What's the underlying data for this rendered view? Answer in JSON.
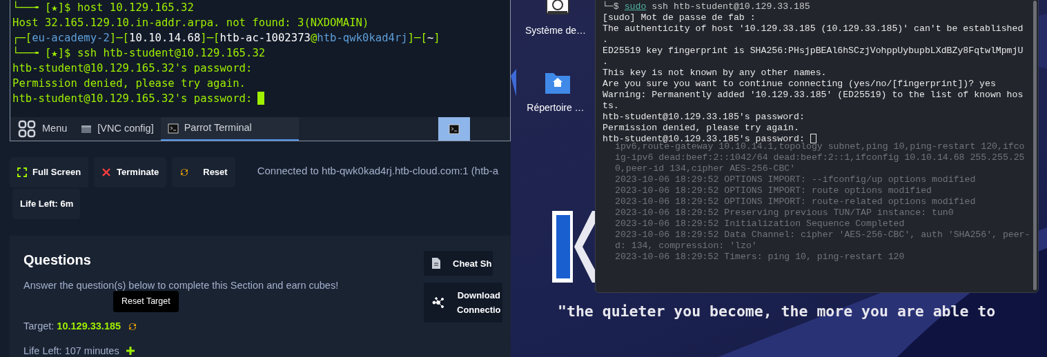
{
  "vnc": {
    "terminal_lines": [
      {
        "segments": [
          {
            "text": "└──╼ ",
            "color": "#9fef00"
          },
          {
            "text": "[★]$ host 10.129.165.32",
            "color": "#9fef00"
          }
        ]
      },
      {
        "segments": [
          {
            "text": "Host 32.165.129.10.in-addr.arpa. not found: 3(NXDOMAIN)",
            "color": "#9fef00"
          }
        ]
      },
      {
        "segments": [
          {
            "text": "┌─[",
            "color": "#9fef00"
          },
          {
            "text": "eu-academy-2",
            "color": "#5f9fd8"
          },
          {
            "text": "]─[",
            "color": "#9fef00"
          },
          {
            "text": "10.10.14.68",
            "color": "#ffffff"
          },
          {
            "text": "]─[",
            "color": "#9fef00"
          },
          {
            "text": "htb-ac-1002373",
            "color": "#ffffff"
          },
          {
            "text": "@",
            "color": "#9fef00"
          },
          {
            "text": "htb-qwk0kad4rj",
            "color": "#5f9fd8"
          },
          {
            "text": "]─[",
            "color": "#9fef00"
          },
          {
            "text": "~",
            "color": "#ffffff"
          },
          {
            "text": "]",
            "color": "#9fef00"
          }
        ]
      },
      {
        "segments": [
          {
            "text": "└──╼ ",
            "color": "#9fef00"
          },
          {
            "text": "[★]$ ssh htb-student@10.129.165.32",
            "color": "#9fef00"
          }
        ]
      },
      {
        "segments": [
          {
            "text": "htb-student@10.129.165.32's password:",
            "color": "#9fef00"
          }
        ]
      },
      {
        "segments": [
          {
            "text": "Permission denied, please try again.",
            "color": "#9fef00"
          }
        ]
      },
      {
        "segments": [
          {
            "text": "htb-student@10.129.165.32's password:",
            "color": "#9fef00"
          }
        ],
        "cursor": true
      }
    ],
    "taskbar": [
      {
        "kind": "menu",
        "label": "Menu",
        "selected": false
      },
      {
        "kind": "window",
        "label": "[VNC config]",
        "selected": false
      },
      {
        "kind": "terminal",
        "label": "Parrot Terminal",
        "selected": true
      }
    ],
    "tray": {
      "selected": true
    }
  },
  "toolbar": {
    "buttons": [
      {
        "kind": "fullscreen",
        "label": "Full Screen"
      },
      {
        "kind": "terminate",
        "label": "Terminate"
      },
      {
        "kind": "reset",
        "label": "Reset"
      }
    ],
    "connection": "Connected to htb-qwk0kad4rj.htb-cloud.com:1 (htb-a",
    "life_left": "Life Left: 6m"
  },
  "questions": {
    "title": "Questions",
    "subtitle": "Answer the question(s) below to complete this Section and earn cubes!",
    "tooltip": "Reset Target",
    "target_label": "Target:",
    "target_ip": "10.129.33.185",
    "life_left": "Life Left: 107 minutes",
    "side_buttons": [
      {
        "kind": "sheet",
        "lines": [
          "Cheat Sh"
        ]
      },
      {
        "kind": "network",
        "lines": [
          "Download",
          "Connectio"
        ]
      }
    ]
  },
  "desktop": {
    "icons": [
      {
        "kind": "drive",
        "label": "Système de…"
      },
      {
        "kind": "home",
        "label": "Répertoire …"
      }
    ],
    "terminal": {
      "lines": [
        {
          "kind": "command",
          "prefix": "└─$ ",
          "sudo": "sudo",
          "text": " ssh htb-student@10.129.33.185"
        },
        {
          "kind": "output",
          "text": "[sudo] Mot de passe de fab :"
        },
        {
          "kind": "output",
          "text": "The authenticity of host '10.129.33.185 (10.129.33.185)' can't be established"
        },
        {
          "kind": "output",
          "text": "."
        },
        {
          "kind": "output",
          "text": "ED25519 key fingerprint is SHA256:PHsjpBEAl6hSCzjVohppUybupbLXdBZy8FqtwlMpmjU"
        },
        {
          "kind": "output",
          "text": "."
        },
        {
          "kind": "output",
          "text": "This key is not known by any other names."
        },
        {
          "kind": "output",
          "text": "Are you sure you want to continue connecting (yes/no/[fingerprint])? yes"
        },
        {
          "kind": "output",
          "text": "Warning: Permanently added '10.129.33.185' (ED25519) to the list of known hos"
        },
        {
          "kind": "output",
          "text": "ts."
        },
        {
          "kind": "output",
          "text": "htb-student@10.129.33.185's password:"
        },
        {
          "kind": "output",
          "text": "Permission denied, please try again."
        },
        {
          "kind": "output",
          "text": "htb-student@10.129.33.185's password:",
          "cursor": true
        }
      ],
      "background_log": [
        "ipv6,route-gateway 10.10.14.1,topology subnet,ping 10,ping-restart 120,ifco",
        "ig-ipv6 dead:beef:2::1042/64 dead:beef:2::1,ifconfig 10.10.14.68 255.255.25",
        "0,peer-id 134,cipher AES-256-CBC'",
        "2023-10-06 18:29:52 OPTIONS IMPORT: --ifconfig/up options modified",
        "2023-10-06 18:29:52 OPTIONS IMPORT: route options modified",
        "2023-10-06 18:29:52 OPTIONS IMPORT: route-related options modified",
        "2023-10-06 18:29:52 Preserving previous TUN/TAP instance: tun0",
        "2023-10-06 18:29:52 Initialization Sequence Completed",
        "2023-10-06 18:29:52 Data Channel: cipher 'AES-256-CBC', auth 'SHA256', peer-",
        "d: 134, compression: 'lzo'",
        "2023-10-06 18:29:52 Timers: ping 10, ping-restart 120"
      ]
    },
    "quote": "\"the quieter you become, the more you are able to"
  }
}
